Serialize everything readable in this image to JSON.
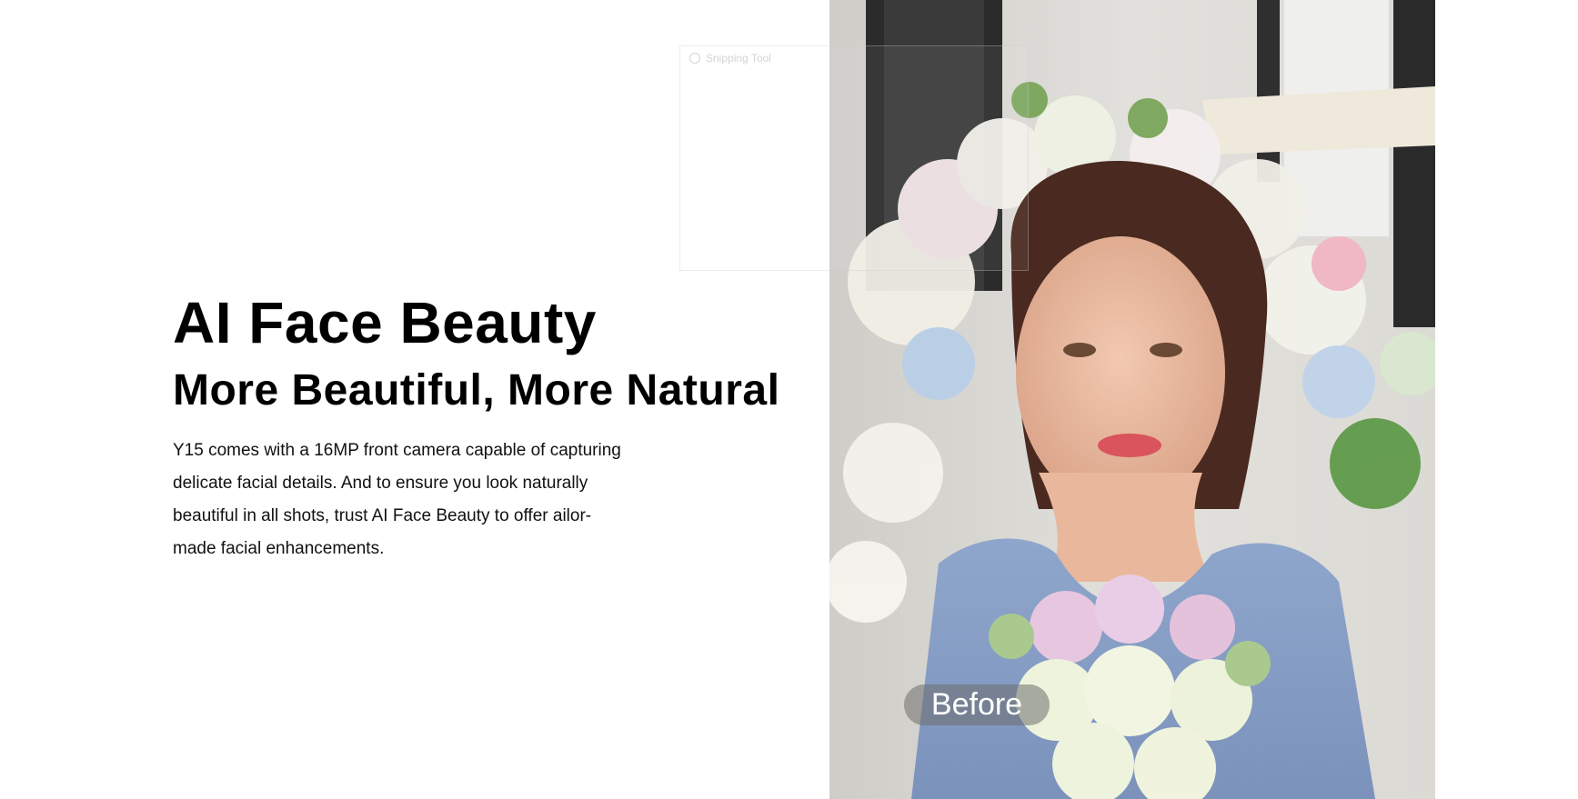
{
  "heading": {
    "title": "AI Face Beauty",
    "subtitle": "More Beautiful, More Natural"
  },
  "body": {
    "description": "Y15 comes with a 16MP front camera capable of capturing delicate facial details. And to ensure you look naturally beautiful in all shots, trust AI Face Beauty to offer ailor-made facial enhancements."
  },
  "photo": {
    "badge_label": "Before"
  },
  "overlay": {
    "title": "Snipping Tool"
  }
}
